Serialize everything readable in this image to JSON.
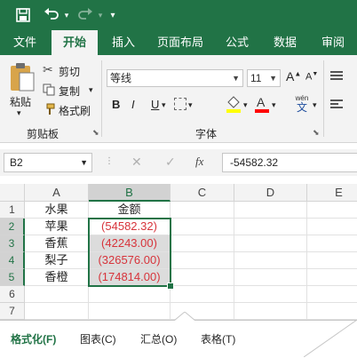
{
  "qat": {
    "customize_glyph": "▾"
  },
  "tabs": [
    {
      "label": "文件"
    },
    {
      "label": "开始"
    },
    {
      "label": "插入"
    },
    {
      "label": "页面布局"
    },
    {
      "label": "公式"
    },
    {
      "label": "数据"
    },
    {
      "label": "审阅"
    }
  ],
  "ribbon": {
    "paste_label": "粘贴",
    "cut_label": "剪切",
    "copy_label": "复制",
    "format_painter_label": "格式刷",
    "clipboard_group": "剪贴板",
    "font_name": "等线",
    "font_size": "11",
    "bold": "B",
    "italic": "I",
    "underline": "U",
    "phonetic_top": "wén",
    "phonetic_bottom": "文",
    "font_group": "字体",
    "colors": {
      "fill": "#ffff00",
      "font": "#ff0000"
    }
  },
  "formula_bar": {
    "name_box": "B2",
    "fx": "fx",
    "value": "-54582.32"
  },
  "sheet": {
    "columns": [
      "A",
      "B",
      "C",
      "D",
      "E"
    ],
    "rows": [
      "1",
      "2",
      "3",
      "4",
      "5",
      "6",
      "7"
    ],
    "cells": {
      "A1": "水果",
      "B1": "金额",
      "A2": "苹果",
      "B2": "(54582.32)",
      "A3": "香蕉",
      "B3": "(42243.00)",
      "A4": "梨子",
      "B4": "(326576.00)",
      "A5": "香橙",
      "B5": "(174814.00)"
    }
  },
  "quick_analysis": {
    "tabs": [
      {
        "label": "格式化(F)"
      },
      {
        "label": "图表(C)"
      },
      {
        "label": "汇总(O)"
      },
      {
        "label": "表格(T)"
      }
    ]
  }
}
